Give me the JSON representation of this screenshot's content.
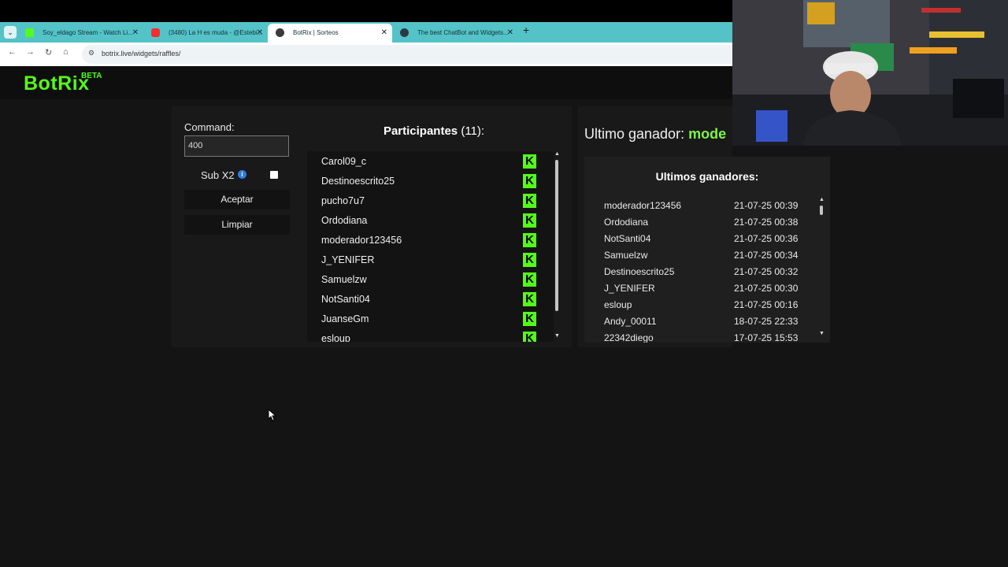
{
  "browser": {
    "tabs": [
      {
        "title": "Soy_eldago Stream - Watch Li...",
        "fav_color": "#53fc18"
      },
      {
        "title": "(3480) La H es muda - @Estebi...",
        "fav_color": "#ff2a2a"
      },
      {
        "title": "BotRix | Sorteos",
        "fav_color": "#3a3a3a"
      },
      {
        "title": "The best ChatBot and Widgets...",
        "fav_color": "#2a3a44"
      }
    ],
    "new_tab": "+",
    "url": "botrix.live/widgets/raffles/"
  },
  "app": {
    "logo": "BotRix",
    "logo_badge": "BETA"
  },
  "controls": {
    "command_label": "Command:",
    "command_value": "400",
    "sub_label": "Sub X2",
    "info_icon": "i",
    "accept_label": "Aceptar",
    "clear_label": "Limpiar"
  },
  "participants": {
    "title": "Participantes",
    "count": "(11):",
    "platform_icon": "K",
    "items": [
      "Carol09_c",
      "Destinoescrito25",
      "pucho7u7",
      "Ordodiana",
      "moderador123456",
      "J_YENIFER",
      "Samuelzw",
      "NotSanti04",
      "JuanseGm",
      "esloup"
    ]
  },
  "winner": {
    "label": "Ultimo ganador:",
    "name": "mode"
  },
  "last_winners": {
    "title": "Ultimos ganadores:",
    "items": [
      {
        "name": "moderador123456",
        "date": "21-07-25 00:39"
      },
      {
        "name": "Ordodiana",
        "date": "21-07-25 00:38"
      },
      {
        "name": "NotSanti04",
        "date": "21-07-25 00:36"
      },
      {
        "name": "Samuelzw",
        "date": "21-07-25 00:34"
      },
      {
        "name": "Destinoescrito25",
        "date": "21-07-25 00:32"
      },
      {
        "name": "J_YENIFER",
        "date": "21-07-25 00:30"
      },
      {
        "name": "esloup",
        "date": "21-07-25 00:16"
      },
      {
        "name": "Andy_00011",
        "date": "18-07-25 22:33"
      },
      {
        "name": "22342diego",
        "date": "17-07-25 15:53"
      }
    ]
  },
  "colors": {
    "accent": "#53fc18",
    "winner_name": "#7df542",
    "background": "#141414"
  }
}
